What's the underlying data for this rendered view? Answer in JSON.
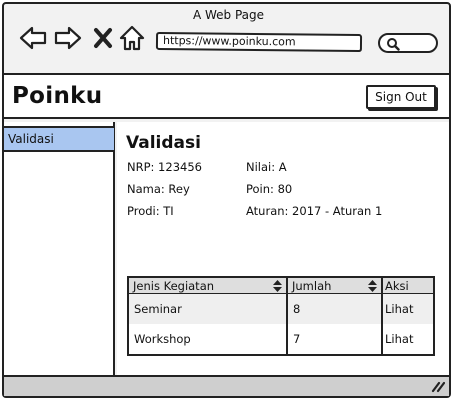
{
  "browser": {
    "title": "A Web Page",
    "url": "https://www.poinku.com",
    "icons": [
      "back-arrow-icon",
      "forward-arrow-icon",
      "close-icon",
      "home-icon",
      "search-icon"
    ]
  },
  "app": {
    "title": "Poinku",
    "sign_out": "Sign Out"
  },
  "sidebar": {
    "items": [
      {
        "label": "Validasi",
        "active": true,
        "color": "#a9c6f0"
      }
    ]
  },
  "main": {
    "title": "Validasi",
    "fields": {
      "nrp": "NRP: 123456",
      "nama": "Nama: Rey",
      "prodi": "Prodi: TI",
      "nilai": "Nilai: A",
      "poin": "Poin: 80",
      "aturan": "Aturan: 2017 - Aturan 1"
    },
    "table": {
      "headers": [
        "Jenis Kegiatan",
        "Jumlah",
        "Aksi"
      ],
      "rows": [
        {
          "jenis": "Seminar",
          "jumlah": "8",
          "aksi": "Lihat"
        },
        {
          "jenis": "Workshop",
          "jumlah": "7",
          "aksi": "Lihat"
        }
      ]
    }
  }
}
